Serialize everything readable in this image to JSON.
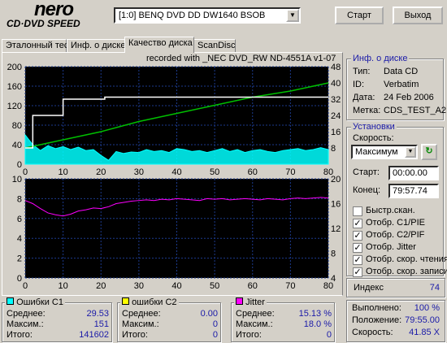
{
  "logo": {
    "brand": "nero",
    "product": "CD·DVD SPEED"
  },
  "drive": {
    "selected": "[1:0]  BENQ DVD DD DW1640 BSOB"
  },
  "buttons": {
    "start": "Старт",
    "exit": "Выход"
  },
  "tabs": [
    {
      "label": "Эталонный тест"
    },
    {
      "label": "Инф. о диске"
    },
    {
      "label": "Качество диска"
    },
    {
      "label": "ScanDisc"
    }
  ],
  "recorded_with": "recorded with _NEC   DVD_RW ND-4551A  v1-07",
  "disc_info": {
    "title": "Инф. о диске",
    "rows": [
      {
        "key": "Тип:",
        "value": "Data CD"
      },
      {
        "key": "ID:",
        "value": "Verbatim"
      },
      {
        "key": "Дата:",
        "value": "24 Feb 2006"
      },
      {
        "key": "Метка:",
        "value": "CDS_TEST_A2"
      }
    ]
  },
  "settings": {
    "title": "Установки",
    "speed_label": "Скорость:",
    "speed_value": "Максимум",
    "start_label": "Старт:",
    "start_value": "00:00.00",
    "end_label": "Конец:",
    "end_value": "79:57.74",
    "checkboxes": [
      {
        "label": "Быстр.скан.",
        "checked": false
      },
      {
        "label": "Отобр. C1/PIE",
        "checked": true
      },
      {
        "label": "Отобр. C2/PIF",
        "checked": true
      },
      {
        "label": "Отобр. Jitter",
        "checked": true
      },
      {
        "label": "Отобр. скор. чтения",
        "checked": true
      },
      {
        "label": "Отобр. скор. записи",
        "checked": true
      }
    ]
  },
  "index": {
    "label": "Индекс",
    "value": "74"
  },
  "progress": {
    "rows": [
      {
        "key": "Выполнено:",
        "value": "100 %"
      },
      {
        "key": "Положение:",
        "value": "79:55.00"
      },
      {
        "key": "Скорость:",
        "value": "41.85 X"
      }
    ]
  },
  "stats": {
    "c1": {
      "title": "Ошибки C1",
      "color": "#00ffff",
      "rows": [
        {
          "key": "Среднее:",
          "value": "29.53"
        },
        {
          "key": "Максим.:",
          "value": "151"
        },
        {
          "key": "Итого:",
          "value": "141602"
        }
      ]
    },
    "c2": {
      "title": "ошибки C2",
      "color": "#ffff00",
      "rows": [
        {
          "key": "Среднее:",
          "value": "0.00"
        },
        {
          "key": "Максим.:",
          "value": "0"
        },
        {
          "key": "Итого:",
          "value": "0"
        }
      ]
    },
    "jitter": {
      "title": "Jitter",
      "color": "#ff00ff",
      "rows": [
        {
          "key": "Среднее:",
          "value": "15.13 %"
        },
        {
          "key": "Максим.:",
          "value": "18.0 %"
        },
        {
          "key": "Итого:",
          "value": "0"
        }
      ]
    }
  },
  "chart_data": [
    {
      "type": "area",
      "xlim": [
        0,
        80
      ],
      "ylim_left": [
        0,
        200
      ],
      "ylim_right": [
        0,
        48
      ],
      "x_ticks": [
        "0",
        "10",
        "20",
        "30",
        "40",
        "50",
        "60",
        "70",
        "80"
      ],
      "y_ticks_left": [
        "0",
        "40",
        "80",
        "120",
        "160",
        "200"
      ],
      "y_ticks_right": [
        "8",
        "16",
        "24",
        "32",
        "40",
        "48"
      ],
      "series": [
        {
          "color": "#00ffff",
          "x": [
            0,
            2,
            4,
            6,
            8,
            10,
            12,
            14,
            16,
            18,
            20,
            22,
            24,
            26,
            28,
            30,
            32,
            34,
            36,
            38,
            40,
            42,
            44,
            46,
            48,
            50,
            52,
            54,
            56,
            58,
            60,
            62,
            64,
            66,
            68,
            70,
            72,
            74,
            76,
            78,
            80
          ],
          "values": [
            60,
            40,
            28,
            38,
            32,
            36,
            30,
            35,
            28,
            30,
            18,
            8,
            26,
            22,
            25,
            24,
            30,
            26,
            28,
            24,
            32,
            30,
            26,
            28,
            24,
            28,
            32,
            26,
            30,
            24,
            28,
            30,
            26,
            24,
            28,
            30,
            32,
            28,
            30,
            34,
            30
          ]
        },
        {
          "color": "#00c000",
          "x": [
            0,
            10,
            20,
            30,
            40,
            50,
            60,
            70,
            80
          ],
          "values": [
            8,
            12,
            16,
            21,
            25,
            29,
            33,
            36,
            40
          ]
        },
        {
          "color": "#ffffff",
          "x": [
            0,
            2,
            2,
            10,
            10,
            21,
            21,
            80
          ],
          "values": [
            8,
            8,
            24,
            24,
            32,
            32,
            33,
            33
          ]
        }
      ]
    },
    {
      "type": "line",
      "xlim": [
        0,
        80
      ],
      "ylim_left": [
        0,
        10
      ],
      "ylim_right": [
        4,
        20
      ],
      "x_ticks": [
        "0",
        "10",
        "20",
        "30",
        "40",
        "50",
        "60",
        "70",
        "80"
      ],
      "y_ticks_left": [
        "0",
        "2",
        "4",
        "6",
        "8",
        "10"
      ],
      "y_ticks_right": [
        "4",
        "8",
        "12",
        "16",
        "20"
      ],
      "series": [
        {
          "color": "#ff00ff",
          "x": [
            0,
            2,
            4,
            6,
            8,
            10,
            12,
            14,
            16,
            18,
            20,
            22,
            24,
            26,
            28,
            30,
            32,
            34,
            36,
            38,
            40,
            42,
            44,
            46,
            48,
            50,
            52,
            54,
            56,
            58,
            60,
            62,
            64,
            66,
            68,
            70,
            72,
            74,
            76,
            78,
            80
          ],
          "values": [
            16.5,
            16.0,
            15.2,
            14.5,
            14.2,
            14.0,
            14.3,
            14.8,
            15.0,
            15.3,
            15.2,
            15.5,
            16.0,
            16.2,
            16.4,
            16.5,
            16.6,
            16.5,
            16.7,
            16.6,
            16.8,
            16.7,
            16.6,
            16.5,
            16.8,
            16.7,
            16.8,
            16.6,
            16.7,
            16.8,
            16.7,
            16.6,
            16.8,
            16.7,
            16.6,
            16.8,
            16.9,
            16.8,
            16.9,
            17.0,
            16.9
          ]
        }
      ]
    }
  ]
}
